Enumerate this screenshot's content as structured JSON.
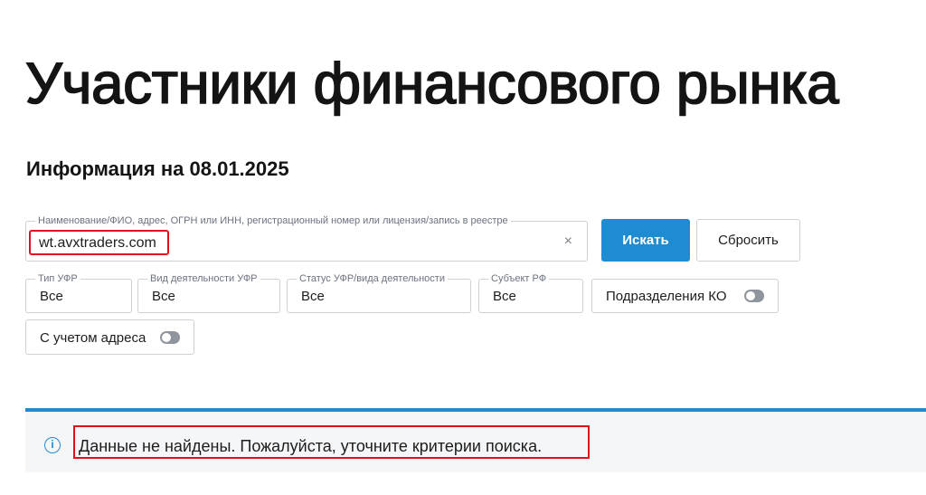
{
  "page": {
    "title": "Участники финансового рынка",
    "info_date": "Информация на 08.01.2025"
  },
  "search": {
    "legend": "Наименование/ФИО, адрес, ОГРН или ИНН, регистрационный номер или лицензия/запись в реестре",
    "value": "wt.avxtraders.com",
    "clear_glyph": "×",
    "search_button": "Искать",
    "reset_button": "Сбросить"
  },
  "filters": [
    {
      "legend": "Тип УФР",
      "value": "Все"
    },
    {
      "legend": "Вид деятельности УФР",
      "value": "Все"
    },
    {
      "legend": "Статус УФР/вида деятельности",
      "value": "Все"
    },
    {
      "legend": "Субъект РФ",
      "value": "Все"
    }
  ],
  "toggles": {
    "ko_label": "Подразделения КО",
    "ko_on": false,
    "address_label": "С учетом адреса",
    "address_on": false
  },
  "notice": {
    "icon": "info-icon",
    "glyph": "i",
    "text": "Данные не найдены. Пожалуйста, уточните критерии поиска."
  },
  "colors": {
    "accent": "#1f8bd1",
    "highlight": "#e0111b",
    "notice_bg": "#f5f6f8"
  }
}
